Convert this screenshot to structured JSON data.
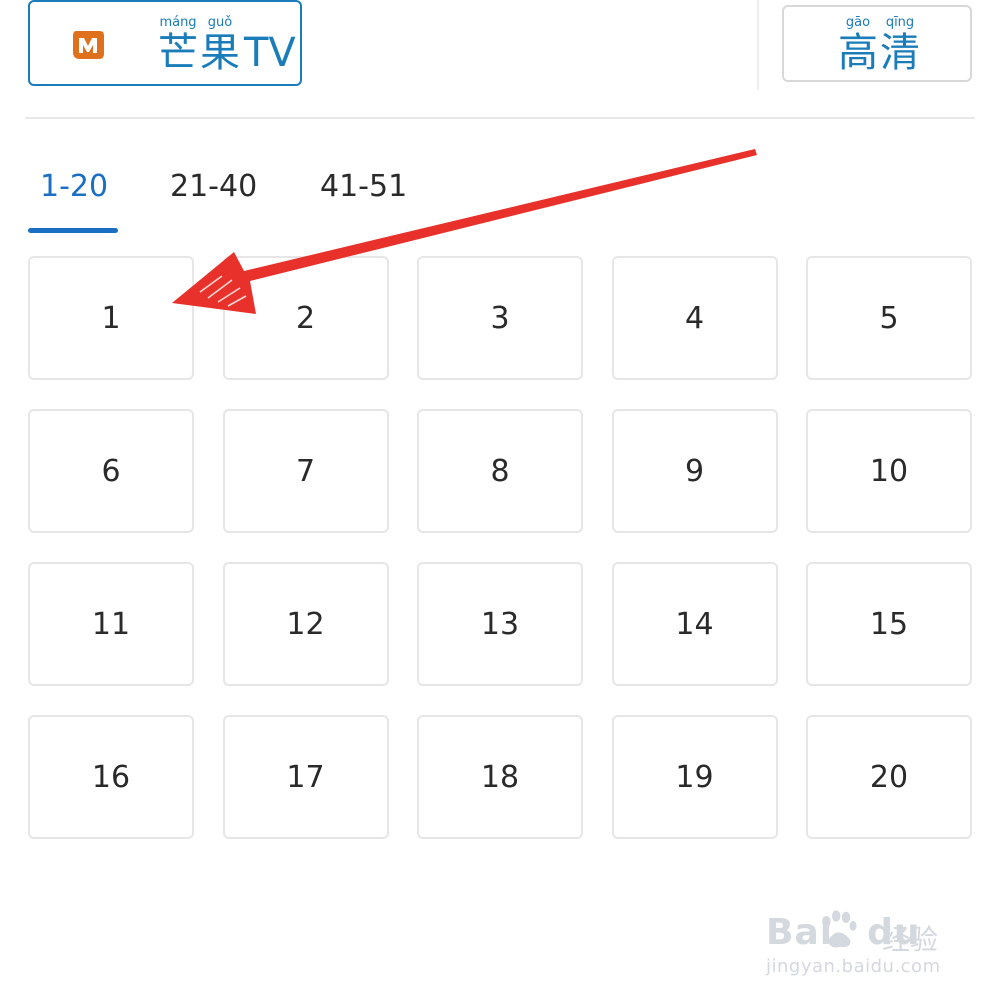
{
  "header": {
    "source": {
      "chars": [
        {
          "pinyin": "máng",
          "hanzi": "芒"
        },
        {
          "pinyin": "guǒ",
          "hanzi": "果"
        }
      ],
      "suffix": "TV",
      "icon": "mango-tv-logo"
    },
    "quality": {
      "chars": [
        {
          "pinyin": "gāo",
          "hanzi": "高"
        },
        {
          "pinyin": "qīng",
          "hanzi": "清"
        }
      ]
    }
  },
  "tabs": [
    {
      "label": "1-20",
      "active": true
    },
    {
      "label": "21-40",
      "active": false
    },
    {
      "label": "41-51",
      "active": false
    }
  ],
  "episodes": [
    "1",
    "2",
    "3",
    "4",
    "5",
    "6",
    "7",
    "8",
    "9",
    "10",
    "11",
    "12",
    "13",
    "14",
    "15",
    "16",
    "17",
    "18",
    "19",
    "20"
  ],
  "annotation": {
    "icon": "red-arrow-pointing-to-episode-1",
    "color": "#e8312a"
  },
  "watermark": {
    "brand": "Bai",
    "brand2": "du",
    "product": "经验",
    "url": "jingyan.baidu.com"
  },
  "colors": {
    "accent": "#1a6fc4",
    "brand": "#1a7cb8",
    "logo": "#e0711c"
  }
}
